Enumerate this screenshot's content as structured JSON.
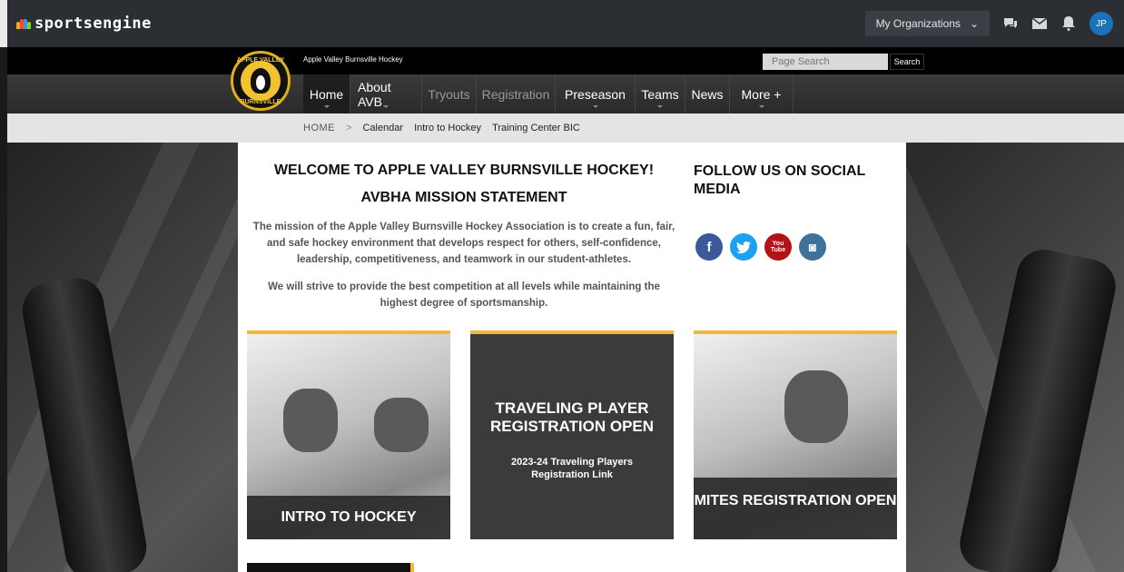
{
  "sportsengine": {
    "logo": "sportsengine",
    "org_button": "My Organizations",
    "avatar_initials": "JP"
  },
  "site": {
    "name": "Apple Valley Burnsville Hockey",
    "search_placeholder": "Page Search",
    "search_button": "Search",
    "badge_top": "APPLE VALLEY",
    "badge_bottom": "BURNSVILLE"
  },
  "nav": {
    "items": [
      {
        "label": "Home"
      },
      {
        "label": "About AVB"
      },
      {
        "label": "Tryouts"
      },
      {
        "label": "Registration"
      },
      {
        "label": "Preseason"
      },
      {
        "label": "Teams"
      },
      {
        "label": "News"
      },
      {
        "label": "More +"
      }
    ]
  },
  "breadcrumb": {
    "home": "HOME",
    "sep": ">",
    "links": [
      "Calendar",
      "Intro to Hockey",
      "Training Center BIC"
    ]
  },
  "main": {
    "welcome": "WELCOME TO APPLE VALLEY BURNSVILLE HOCKEY!",
    "mission_title": "AVBHA MISSION STATEMENT",
    "mission_text": "The mission of the Apple Valley Burnsville Hockey Association is to create a fun, fair, and safe hockey environment that develops respect for others, self-confidence, leadership, competitiveness, and teamwork in our student-athletes.",
    "mission_text2": "We will strive to provide the best competition at all levels while maintaining the highest degree of sportsmanship.",
    "follow_title": "FOLLOW US ON SOCIAL MEDIA"
  },
  "social": {
    "facebook_glyph": "f",
    "twitter_glyph": "t",
    "youtube_glyph": "You Tube",
    "instagram_glyph": "◙"
  },
  "cards": {
    "intro": "INTRO TO HOCKEY",
    "traveling_title": "TRAVELING PLAYER REGISTRATION OPEN",
    "traveling_sub": "2023-24 Traveling Players Registration Link",
    "mites": "MITES REGISTRATION OPEN"
  },
  "colors": {
    "accent": "#f3b731",
    "facebook": "#3b5998",
    "twitter": "#1da1f2",
    "youtube": "#b31217",
    "instagram": "#3f729b"
  }
}
